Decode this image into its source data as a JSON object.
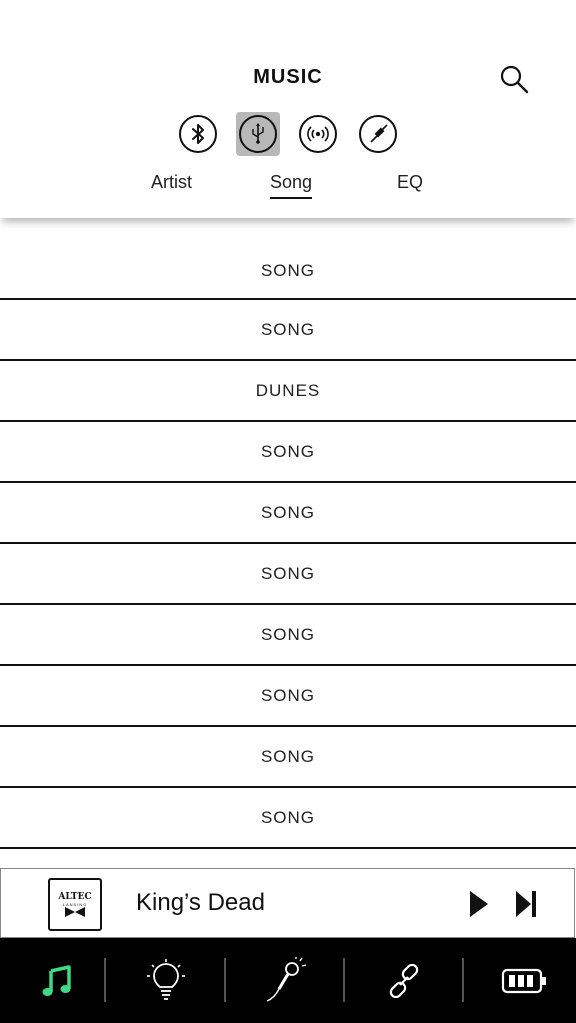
{
  "header": {
    "title": "MUSIC",
    "search_icon": "search-icon"
  },
  "sources": [
    {
      "name": "bluetooth",
      "icon": "bluetooth-icon",
      "active": false
    },
    {
      "name": "usb",
      "icon": "usb-icon",
      "active": true
    },
    {
      "name": "radio",
      "icon": "broadcast-icon",
      "active": false
    },
    {
      "name": "aux",
      "icon": "aux-cable-icon",
      "active": false
    }
  ],
  "tabs": [
    {
      "label": "Artist",
      "active": false
    },
    {
      "label": "Song",
      "active": true
    },
    {
      "label": "EQ",
      "active": false
    }
  ],
  "songs": [
    "SONG",
    "SONG",
    "DUNES",
    "SONG",
    "SONG",
    "SONG",
    "SONG",
    "SONG",
    "SONG",
    "SONG"
  ],
  "now_playing": {
    "album_brand": "ALTEC",
    "album_sub": "LANSING",
    "title": "King’s Dead",
    "play_icon": "play-icon",
    "next_icon": "skip-next-icon"
  },
  "tabbar": {
    "items": [
      {
        "name": "music",
        "icon": "music-note-icon",
        "active": true
      },
      {
        "name": "light",
        "icon": "light-bulb-icon",
        "active": false
      },
      {
        "name": "karaoke",
        "icon": "microphone-icon",
        "active": false
      },
      {
        "name": "link",
        "icon": "link-icon",
        "active": false
      },
      {
        "name": "battery",
        "icon": "battery-icon",
        "active": false
      }
    ],
    "active_color": "#3ddc84"
  }
}
